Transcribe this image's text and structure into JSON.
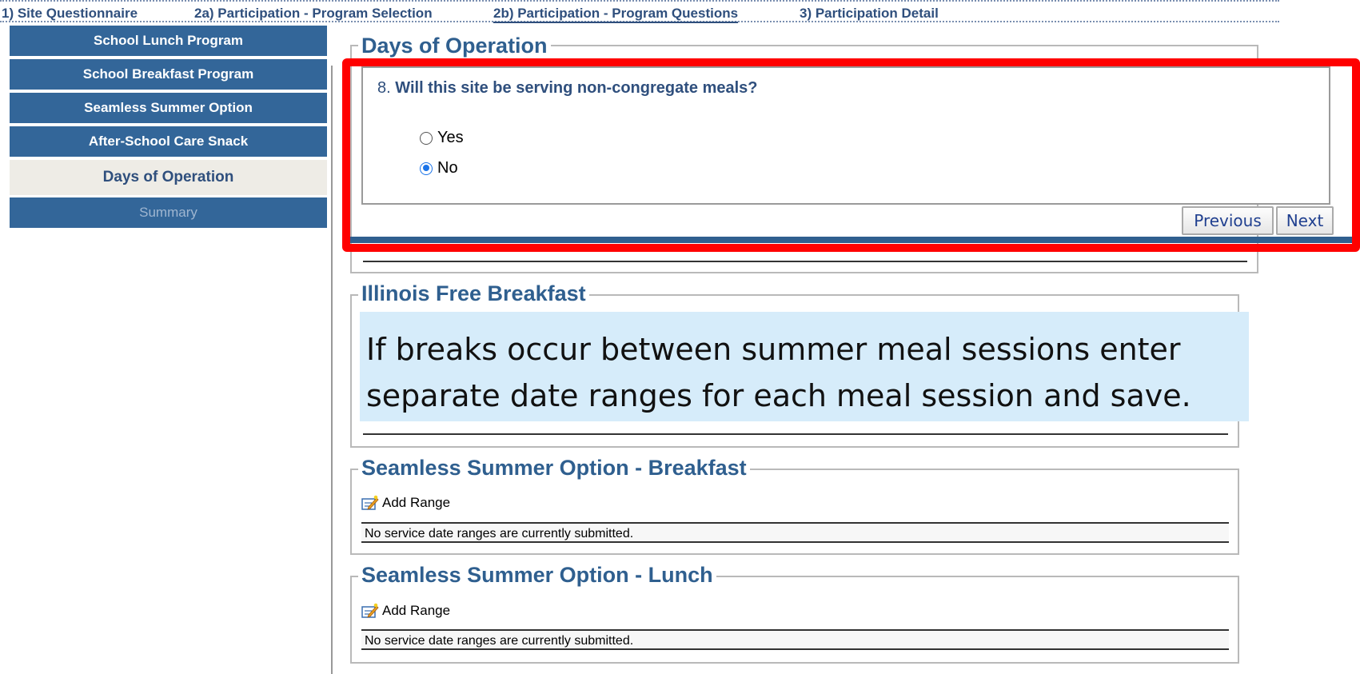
{
  "tabs": [
    {
      "label": "1) Site Questionnaire"
    },
    {
      "label": "2a) Participation - Program Selection"
    },
    {
      "label": "2b) Participation - Program Questions"
    },
    {
      "label": "3) Participation Detail"
    }
  ],
  "sidebar": {
    "items": [
      {
        "label": "School Lunch Program"
      },
      {
        "label": "School Breakfast Program"
      },
      {
        "label": "Seamless Summer Option"
      },
      {
        "label": "After-School Care Snack"
      },
      {
        "label": "Days of Operation"
      },
      {
        "label": "Summary"
      }
    ]
  },
  "days_section": {
    "legend": "Days of Operation",
    "question_number": "8.",
    "question_text": "Will this site be serving non-congregate meals?",
    "options": [
      {
        "label": "Yes",
        "checked": false
      },
      {
        "label": "No",
        "checked": true
      }
    ],
    "previous_label": "Previous",
    "next_label": "Next"
  },
  "illinois_section": {
    "legend": "Illinois Free Breakfast"
  },
  "callout": {
    "line1": "If breaks occur between summer meal sessions enter",
    "line2": "separate date ranges for each meal session and save."
  },
  "sso_breakfast": {
    "legend": "Seamless Summer Option - Breakfast",
    "add_label": "Add Range",
    "empty_message": "No service date ranges are currently submitted."
  },
  "sso_lunch": {
    "legend": "Seamless Summer Option - Lunch",
    "add_label": "Add Range",
    "empty_message": "No service date ranges are currently submitted."
  },
  "colors": {
    "nav_blue": "#336699",
    "highlight_red": "#ff0000",
    "callout_bg": "#d6ecfa"
  }
}
